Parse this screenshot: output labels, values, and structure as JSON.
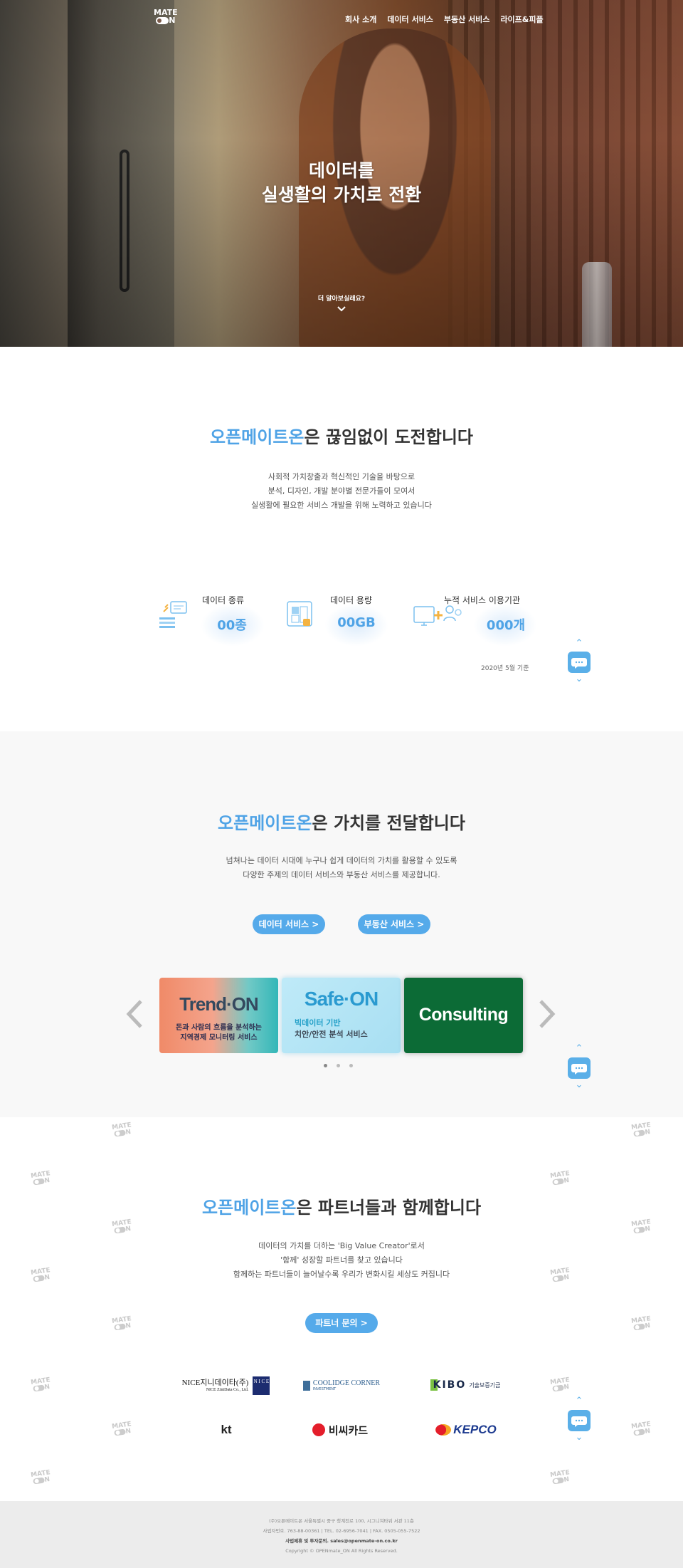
{
  "header": {
    "logo_top": "MATE",
    "logo_bottom": "N",
    "nav": [
      "회사 소개",
      "데이터 서비스",
      "부동산 서비스",
      "라이프&피플"
    ]
  },
  "hero": {
    "title_line1": "데이터를",
    "title_line2": "실생활의 가치로 전환",
    "more": "더 알아보실래요?"
  },
  "intro": {
    "title_accent": "오픈메이트온",
    "title_rest": "은 끊임없이 도전합니다",
    "desc": [
      "사회적 가치창출과 혁신적인 기술을 바탕으로",
      "분석, 디자인, 개발 분야별 전문가들이 모여서",
      "실생활에 필요한 서비스 개발을 위해 노력하고 있습니다"
    ],
    "stats": [
      {
        "label": "데이터 종류",
        "value": "00종"
      },
      {
        "label": "데이터 용량",
        "value": "00GB"
      },
      {
        "label": "누적 서비스 이용기관",
        "value": "000개"
      }
    ],
    "note": "2020년 5월 기준"
  },
  "value": {
    "title_accent": "오픈메이트온",
    "title_rest": "은 가치를 전달합니다",
    "desc": [
      "넘쳐나는 데이터 시대에 누구나 쉽게 데이터의 가치를 활용할 수 있도록",
      "다양한 주제의 데이터 서비스와 부동산 서비스를 제공합니다."
    ],
    "btn_data": "데이터 서비스 >",
    "btn_realestate": "부동산 서비스 >",
    "cards": [
      {
        "brand": "Trend·ON",
        "line1": "돈과 사람의 흐름을 분석하는",
        "line2": "지역경제 모니터링 서비스"
      },
      {
        "brand": "Safe·ON",
        "line1": "빅데이터 기반",
        "line2": "치안/안전 분석 서비스"
      },
      {
        "brand": "Consulting"
      }
    ]
  },
  "partners": {
    "title_accent": "오픈메이트온",
    "title_rest": "은 파트너들과 함께합니다",
    "desc": [
      "데이터의 가치를 더하는 'Big Value Creator'로서",
      "'함께' 성장할 파트너를 찾고 있습니다",
      "함께하는 파트너들이 늘어날수록 우리가 변화시킬 세상도 커집니다"
    ],
    "btn": "파트너 문의 >",
    "logos": [
      {
        "name": "NICE지니데이타(주)",
        "sub": "NICE ZiniData Co., Ltd.",
        "mark": "N I C E"
      },
      {
        "name": "Coolidge Corner",
        "sub": "INVESTMENT"
      },
      {
        "name": "KIBO",
        "sub": "기술보증기금"
      },
      {
        "name": "kt"
      },
      {
        "name": "비씨카드"
      },
      {
        "name": "KEPCO"
      }
    ]
  },
  "footer": {
    "line1": "(주)오픈메이트온 서울특별시 중구 청계천로 100, 시그니쳐타워 서관 11층",
    "line2": "사업자번호. 763-88-00361 | TEL. 02-6956-7041 | FAX. 0505-055-7522",
    "line3": "사업제휴 및 투자문의. sales@openmate-on.co.kr",
    "line4": "Copyright © OPENmate_ON All Rights Reserved."
  },
  "chat_icon": "chat-bubble-icon",
  "colors": {
    "accent": "#4fa3e6",
    "button": "#55aaea",
    "consulting_green": "#0c6b36"
  }
}
